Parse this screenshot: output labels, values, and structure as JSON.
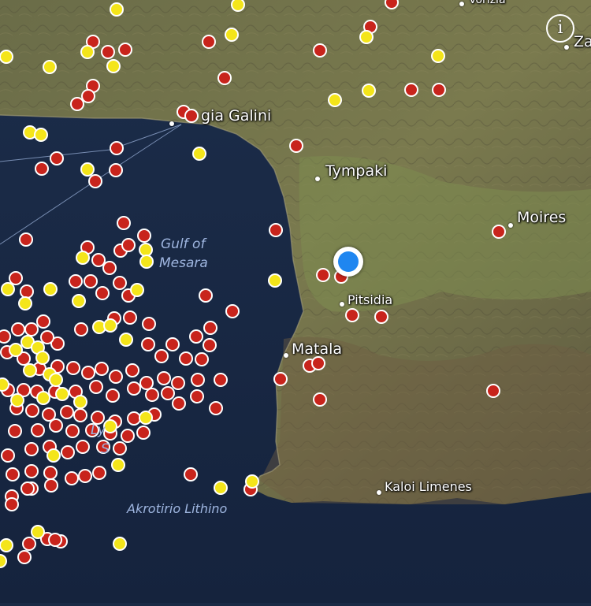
{
  "map": {
    "labels": {
      "agia_galini": "gia Galini",
      "tympaki": "Tympaki",
      "moires": "Moires",
      "pitsidia": "Pitsidia",
      "matala": "Matala",
      "kaloi_limenes": "Kaloi Limenes",
      "gulf_line1": "Gulf of",
      "gulf_line2": "Mesara",
      "akrotirio": "Akrotirio Lithino",
      "vorizia": "Vorizia",
      "zaros": "Za",
      "sea_partial_1": "Ly",
      "sea_partial_2": "S"
    },
    "info_icon": "info-icon",
    "location_icon": "current-location-icon",
    "colors": {
      "red_marker": "#c8241c",
      "yellow_marker": "#f4e51a",
      "location_blue": "#1f86f0",
      "sea": "#1a2a45",
      "land": "#6f7048"
    }
  }
}
